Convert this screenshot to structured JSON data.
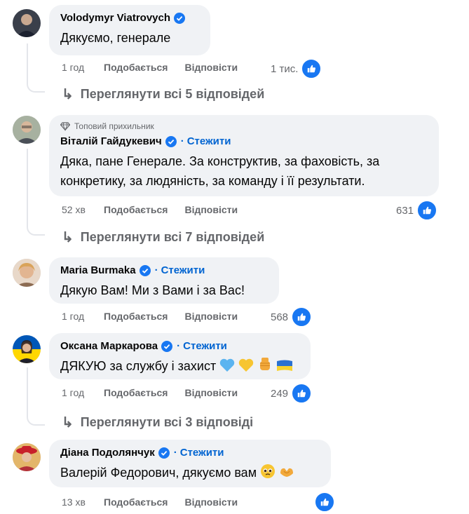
{
  "comments": [
    {
      "author": "Volodymyr Viatrovych",
      "verified": true,
      "follow": "",
      "top_fan": "",
      "text": "Дякуємо, генерале",
      "time": "1 год",
      "like_label": "Подобається",
      "reply_label": "Відповісти",
      "reaction_count": "1 тис.",
      "replies_link": "Переглянути всі 5 відповідей"
    },
    {
      "author": "Віталій Гайдукевич",
      "verified": true,
      "follow": "Стежити",
      "top_fan": "Топовий прихильник",
      "text_line1": "Дяка, пане Генерале. За конструктив, за фаховість, за",
      "text_line2": "конкретику, за людяність, за команду і її результати.",
      "time": "52 хв",
      "like_label": "Подобається",
      "reply_label": "Відповісти",
      "reaction_count": "631",
      "replies_link": "Переглянути всі 7 відповідей"
    },
    {
      "author": "Maria Burmaka",
      "verified": true,
      "follow": "Стежити",
      "text": "Дякую Вам! Ми з Вами і за Вас!",
      "time": "1 год",
      "like_label": "Подобається",
      "reply_label": "Відповісти",
      "reaction_count": "568"
    },
    {
      "author": "Оксана Маркарова",
      "verified": true,
      "follow": "Стежити",
      "text": "ДЯКУЮ за службу і захист",
      "time": "1 год",
      "like_label": "Подобається",
      "reply_label": "Відповісти",
      "reaction_count": "249",
      "replies_link": "Переглянути всі 3 відповіді"
    },
    {
      "author": "Діана Подолянчук",
      "verified": true,
      "follow": "Стежити",
      "text": "Валерій Федорович, дякуємо вам",
      "time": "13 хв",
      "like_label": "Подобається",
      "reply_label": "Відповісти",
      "reaction_count": ""
    }
  ],
  "dot": "·",
  "colors": {
    "link_blue": "#0064d1",
    "like_blue": "#1877f2",
    "bubble": "#f0f2f5",
    "meta": "#65676b"
  }
}
